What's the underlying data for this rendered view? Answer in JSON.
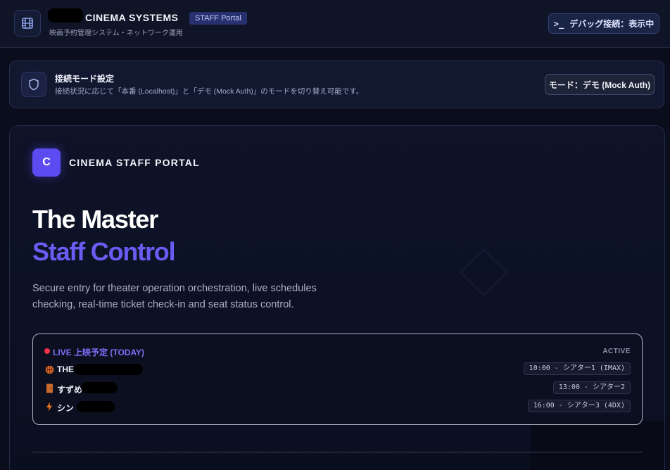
{
  "header": {
    "brand_title": "CINEMA SYSTEMS",
    "brand_badge": "STAFF Portal",
    "brand_subtitle": "映画予約管理システム・ネットワーク運用",
    "debug_prompt": ">_",
    "debug_button": "デバッグ接続：表示中",
    "logo_icon": "film-icon"
  },
  "mode_panel": {
    "icon": "shield-icon",
    "title": "接続モード設定",
    "description": "接続状況に応じて「本番 (Localhost)」と「デモ (Mock Auth)」のモードを切り替え可能です。",
    "mode_button": "モード：デモ (Mock Auth)"
  },
  "main": {
    "logo_letter": "C",
    "portal_title": "CINEMA STAFF PORTAL",
    "hero_line1": "The Master",
    "hero_line2": "Staff Control",
    "description": "Secure entry for theater operation orchestration, live schedules checking, real-time ticket check-in and seat status control.",
    "schedule": {
      "live_label": "LIVE 上映予定 (TODAY)",
      "status": "ACTIVE",
      "items": [
        {
          "icon": "basketball-icon",
          "title": "THE",
          "time": "10:00 - シアター1 (IMAX)"
        },
        {
          "icon": "door-icon",
          "title": "すずめ",
          "time": "13:00 - シアター2"
        },
        {
          "icon": "lightning-icon",
          "title": "シン・",
          "time": "16:00 - シアター3 (4DX)"
        }
      ]
    }
  },
  "colors": {
    "accent": "#6a5cf2",
    "live_dot": "#f0334a",
    "background": "#0a0e1c"
  }
}
